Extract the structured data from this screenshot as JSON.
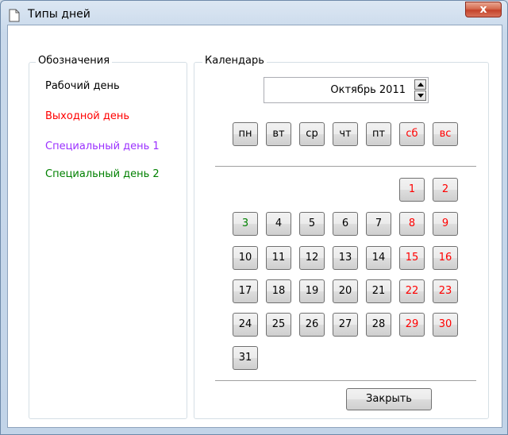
{
  "window": {
    "title": "Типы дней",
    "close_glyph": "x"
  },
  "legend_group": {
    "title": "Обозначения",
    "items": [
      {
        "label": "Рабочий день",
        "color": "#000000"
      },
      {
        "label": "Выходной день",
        "color": "#ff0000"
      },
      {
        "label": "Специальный день 1",
        "color": "#9b30ff"
      },
      {
        "label": "Специальный день 2",
        "color": "#008000"
      }
    ]
  },
  "calendar_group": {
    "title": "Календарь",
    "month_value": "Октябрь 2011",
    "weekdays": [
      {
        "label": "пн",
        "color": "#000000"
      },
      {
        "label": "вт",
        "color": "#000000"
      },
      {
        "label": "ср",
        "color": "#000000"
      },
      {
        "label": "чт",
        "color": "#000000"
      },
      {
        "label": "пт",
        "color": "#000000"
      },
      {
        "label": "сб",
        "color": "#ff0000"
      },
      {
        "label": "вс",
        "color": "#ff0000"
      }
    ],
    "days": [
      {
        "day": "1",
        "weekday": 5,
        "week": 0,
        "color": "#ff0000"
      },
      {
        "day": "2",
        "weekday": 6,
        "week": 0,
        "color": "#ff0000"
      },
      {
        "day": "3",
        "weekday": 0,
        "week": 1,
        "color": "#008000"
      },
      {
        "day": "4",
        "weekday": 1,
        "week": 1,
        "color": "#000000"
      },
      {
        "day": "5",
        "weekday": 2,
        "week": 1,
        "color": "#000000"
      },
      {
        "day": "6",
        "weekday": 3,
        "week": 1,
        "color": "#000000"
      },
      {
        "day": "7",
        "weekday": 4,
        "week": 1,
        "color": "#000000"
      },
      {
        "day": "8",
        "weekday": 5,
        "week": 1,
        "color": "#ff0000"
      },
      {
        "day": "9",
        "weekday": 6,
        "week": 1,
        "color": "#ff0000"
      },
      {
        "day": "10",
        "weekday": 0,
        "week": 2,
        "color": "#000000"
      },
      {
        "day": "11",
        "weekday": 1,
        "week": 2,
        "color": "#000000"
      },
      {
        "day": "12",
        "weekday": 2,
        "week": 2,
        "color": "#000000"
      },
      {
        "day": "13",
        "weekday": 3,
        "week": 2,
        "color": "#000000"
      },
      {
        "day": "14",
        "weekday": 4,
        "week": 2,
        "color": "#000000"
      },
      {
        "day": "15",
        "weekday": 5,
        "week": 2,
        "color": "#ff0000"
      },
      {
        "day": "16",
        "weekday": 6,
        "week": 2,
        "color": "#ff0000"
      },
      {
        "day": "17",
        "weekday": 0,
        "week": 3,
        "color": "#000000"
      },
      {
        "day": "18",
        "weekday": 1,
        "week": 3,
        "color": "#000000"
      },
      {
        "day": "19",
        "weekday": 2,
        "week": 3,
        "color": "#000000"
      },
      {
        "day": "20",
        "weekday": 3,
        "week": 3,
        "color": "#000000"
      },
      {
        "day": "21",
        "weekday": 4,
        "week": 3,
        "color": "#000000"
      },
      {
        "day": "22",
        "weekday": 5,
        "week": 3,
        "color": "#ff0000"
      },
      {
        "day": "23",
        "weekday": 6,
        "week": 3,
        "color": "#ff0000"
      },
      {
        "day": "24",
        "weekday": 0,
        "week": 4,
        "color": "#000000"
      },
      {
        "day": "25",
        "weekday": 1,
        "week": 4,
        "color": "#000000"
      },
      {
        "day": "26",
        "weekday": 2,
        "week": 4,
        "color": "#000000"
      },
      {
        "day": "27",
        "weekday": 3,
        "week": 4,
        "color": "#000000"
      },
      {
        "day": "28",
        "weekday": 4,
        "week": 4,
        "color": "#000000"
      },
      {
        "day": "29",
        "weekday": 5,
        "week": 4,
        "color": "#ff0000"
      },
      {
        "day": "30",
        "weekday": 6,
        "week": 4,
        "color": "#ff0000"
      },
      {
        "day": "31",
        "weekday": 0,
        "week": 5,
        "color": "#000000"
      }
    ],
    "close_button_label": "Закрыть"
  }
}
